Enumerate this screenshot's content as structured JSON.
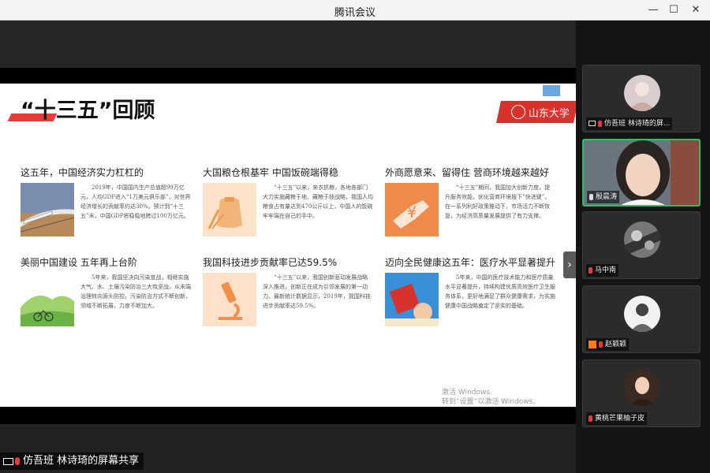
{
  "window": {
    "title": "腾讯会议",
    "min_label": "—",
    "max_label": "☐",
    "close_label": "✕"
  },
  "slide": {
    "heading": "“十三五”回顾",
    "logo_text": "山东大学",
    "cards": [
      {
        "title": "这五年，中国经济实力杠杠的",
        "body": "2019年，中国国内生产总值超99万亿元，人均GDP进入“1万美元俱乐部”，对世界经济增长的贡献率约达30%。预计到“十三五”末，中国GDP将稳稳地跨过100万亿元。",
        "icon": "train-photo-icon"
      },
      {
        "title": "大国粮仓根基牢 中国饭碗端得稳",
        "body": "“十三五”以来，来衣抓粮，各地各部门大力实施藏粮于地、藏粮于技战略，我国人均粮食占有量达到470公斤以上，中国人的饭碗牢牢端在自己的手中。",
        "icon": "grain-sack-icon"
      },
      {
        "title": "外商愿意来、留得住 营商环境越来越好",
        "body": "“十三五”期间，我国加大创新力度，提升服务效能，优化营商环境按下“快进键”，在一系列利好政策推动下，市场活力不断恢复，为经济高质量发展提供了有力支撑。",
        "icon": "yuan-hand-icon"
      },
      {
        "title": "美丽中国建设 五年再上台阶",
        "body": "5年来，我国坚决向污染宣战，相继实施大气、水、土壤污染防治三大攻坚战，从末端治理转向源头防控，污染防治方式不断创新，领域不断拓展，力度不断加大。",
        "icon": "landscape-icon"
      },
      {
        "title": "我国科技进步贡献率已达59.5%",
        "body": "“十三五”以来，我国创新驱动发展战略深入推进，创新正在成为引领发展的第一动力。最新统计数据显示，2019年，我国科技进步贡献率达59.5%。",
        "icon": "microscope-icon"
      },
      {
        "title": "迈向全民健康这五年：医疗水平显著提升",
        "body": "5年来，中国的医疗技术能力和医疗质量水平显著提升，持续构建优质高效医疗卫生服务体系，更好地满足了群众健康需求，为实施健康中国战略奠定了坚实的基础。",
        "icon": "health-poster-icon"
      }
    ],
    "watermark_line1": "激活 Windows",
    "watermark_line2": "转到“设置”以激活 Windows。"
  },
  "share_label": "仿吾班 林诗琦的屏幕共享",
  "participants": [
    {
      "name": "仿吾班 林诗琦的屏...",
      "status": "sharing"
    },
    {
      "name": "殷晨涛",
      "status": "speaking"
    },
    {
      "name": "马中南",
      "status": "muted"
    },
    {
      "name": "赵颖颖",
      "status": "host"
    },
    {
      "name": "黄桃芒果柚子皮",
      "status": "muted"
    }
  ],
  "colors": {
    "accent_red": "#e43b3b",
    "active_border": "#2dbf62",
    "host_orange": "#ff7a1a"
  }
}
